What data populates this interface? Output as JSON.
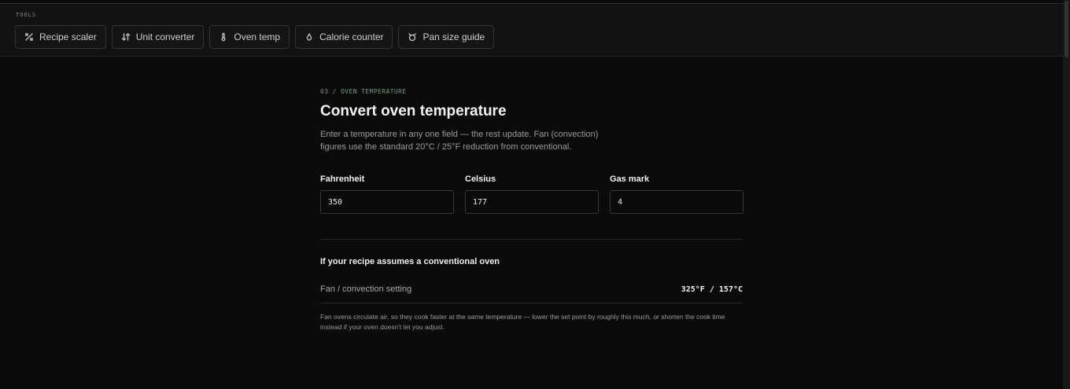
{
  "tools": {
    "label": "TOOLS",
    "items": [
      {
        "icon": "percent-icon",
        "label": "Recipe scaler"
      },
      {
        "icon": "swap-arrows-icon",
        "label": "Unit converter"
      },
      {
        "icon": "thermometer-icon",
        "label": "Oven temp"
      },
      {
        "icon": "flame-icon",
        "label": "Calorie counter"
      },
      {
        "icon": "pan-icon",
        "label": "Pan size guide"
      }
    ]
  },
  "main": {
    "eyebrow": "03 / OVEN TEMPERATURE",
    "title": "Convert oven temperature",
    "description": "Enter a temperature in any one field — the rest update. Fan (convection) figures use the standard 20°C / 25°F reduction from conventional.",
    "fields": [
      {
        "label": "Fahrenheit",
        "value": "350"
      },
      {
        "label": "Celsius",
        "value": "177"
      },
      {
        "label": "Gas mark",
        "value": "4"
      }
    ],
    "section_heading": "If your recipe assumes a conventional oven",
    "result": {
      "label": "Fan / convection setting",
      "value": "325°F / 157°C"
    },
    "note": "Fan ovens circulate air, so they cook faster at the same temperature — lower the set point by roughly this much, or shorten the cook time instead if your oven doesn't let you adjust."
  }
}
